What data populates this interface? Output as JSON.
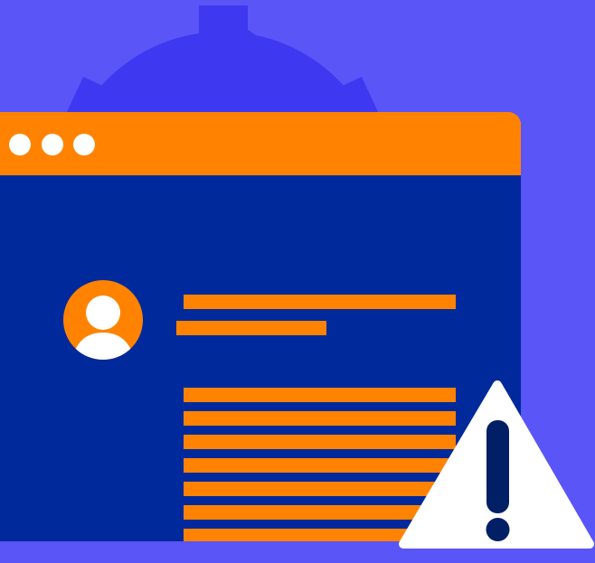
{
  "colors": {
    "background": "#5a55f7",
    "gear": "#3f38f1",
    "window_frame": "#ff8300",
    "window_body": "#00299b",
    "window_dot": "#ffffff",
    "avatar_bg": "#ff8300",
    "avatar_figure": "#ffffff",
    "text_line": "#ff8300",
    "warning_fill": "#ffffff",
    "warning_mark": "#001f64"
  },
  "icons": {
    "gear": "gear-icon",
    "avatar": "user-avatar-icon",
    "warning": "warning-triangle-icon"
  }
}
